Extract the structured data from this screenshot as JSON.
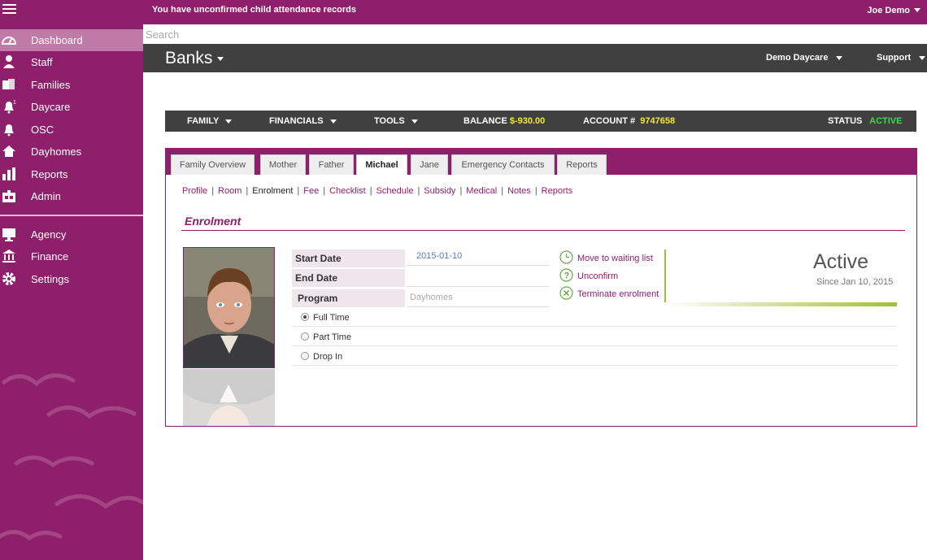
{
  "topbar": {
    "notice": "You have unconfirmed child attendance records",
    "user": "Joe Demo"
  },
  "sidebar": {
    "items": [
      {
        "label": "Dashboard",
        "icon": "gauge-icon"
      },
      {
        "label": "Staff",
        "icon": "person-icon"
      },
      {
        "label": "Families",
        "icon": "family-icon"
      },
      {
        "label": "Daycare",
        "icon": "bell-icon",
        "badge": "1"
      },
      {
        "label": "OSC",
        "icon": "bell-icon"
      },
      {
        "label": "Dayhomes",
        "icon": "home-icon"
      },
      {
        "label": "Reports",
        "icon": "bar-chart-icon"
      },
      {
        "label": "Admin",
        "icon": "admin-icon"
      }
    ],
    "items2": [
      {
        "label": "Agency",
        "icon": "monitor-icon"
      },
      {
        "label": "Finance",
        "icon": "bank-icon"
      },
      {
        "label": "Settings",
        "icon": "gear-icon"
      }
    ],
    "active": "Dashboard"
  },
  "search": {
    "placeholder": "Search"
  },
  "header": {
    "title": "Banks",
    "daycare": "Demo Daycare",
    "support": "Support"
  },
  "menubar": {
    "family": "FAMILY",
    "financials": "FINANCIALS",
    "tools": "TOOLS",
    "balance_label": "BALANCE",
    "balance_value": "$-930.00",
    "account_label": "ACCOUNT #",
    "account_value": "9747658",
    "status_label": "STATUS",
    "status_value": "ACTIVE"
  },
  "tabs": [
    "Family Overview",
    "Mother",
    "Father",
    "Michael",
    "Jane",
    "Emergency Contacts",
    "Reports"
  ],
  "active_tab": "Michael",
  "subnav": [
    "Profile",
    "Room",
    "Enrolment",
    "Fee",
    "Checklist",
    "Schedule",
    "Subsidy",
    "Medical",
    "Notes",
    "Reports"
  ],
  "active_subnav": "Enrolment",
  "section_title": "Enrolment",
  "form": {
    "start_date_label": "Start Date",
    "start_date_value": "2015-01-10",
    "end_date_label": "End Date",
    "end_date_value": "",
    "program_label": "Program",
    "program_value": "Dayhomes",
    "schedule_options": [
      "Full Time",
      "Part Time",
      "Drop In"
    ],
    "schedule_selected": "Full Time"
  },
  "actions": {
    "waiting": "Move to waiting list",
    "unconfirm": "Unconfirm",
    "terminate": "Terminate enrolment"
  },
  "status": {
    "value": "Active",
    "since": "Since Jan 10, 2015"
  },
  "colors": {
    "brand": "#8e1f6b",
    "dark_bar": "#404040",
    "balance": "#f4e542",
    "active": "#41d94a",
    "accent_green": "#9fbf3a"
  }
}
